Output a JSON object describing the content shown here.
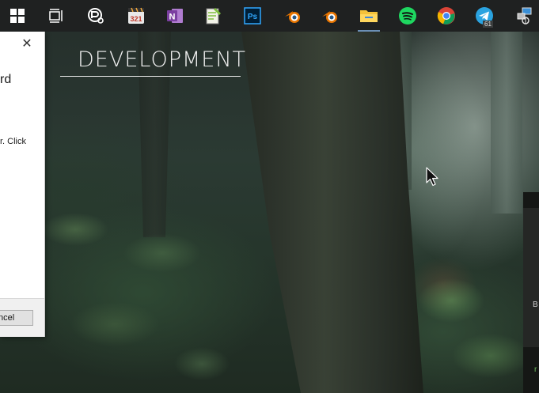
{
  "taskbar": {
    "icons": [
      {
        "name": "windows-start-icon",
        "color": "#ffffff"
      },
      {
        "name": "task-view-icon",
        "color": "#ffffff"
      },
      {
        "name": "screen-recorder-icon",
        "color": "#ffffff"
      },
      {
        "name": "video-editor-icon",
        "label": "321",
        "color": "#f2a93b"
      },
      {
        "name": "onenote-icon",
        "label": "N",
        "color": "#7b3fa1"
      },
      {
        "name": "notepad-plus-icon",
        "color": "#7fbf3f"
      },
      {
        "name": "photoshop-icon",
        "label": "Ps",
        "color": "#31a8ff"
      },
      {
        "name": "blender-icon",
        "color": "#ea7600"
      },
      {
        "name": "blender-icon-2",
        "color": "#ea7600"
      },
      {
        "name": "file-explorer-icon",
        "color": "#f3c13a"
      },
      {
        "name": "spotify-icon",
        "color": "#1ed760"
      },
      {
        "name": "chrome-icon",
        "color": "#4285f4"
      },
      {
        "name": "telegram-icon",
        "badge": "61",
        "color": "#2aa3e0"
      },
      {
        "name": "network-icon",
        "color": "#d0d0d0"
      }
    ]
  },
  "dialog": {
    "close_glyph": "✕",
    "heading_fragment": "rd",
    "text_fragment": "r. Click",
    "cancel_label": "ancel"
  },
  "desktop": {
    "title": "DEVELOPMENT"
  },
  "side_panel": {
    "b_label": "B",
    "r_label": "r"
  },
  "colors": {
    "taskbar_bg": "#1f2121",
    "accent": "#6b8fb5"
  }
}
